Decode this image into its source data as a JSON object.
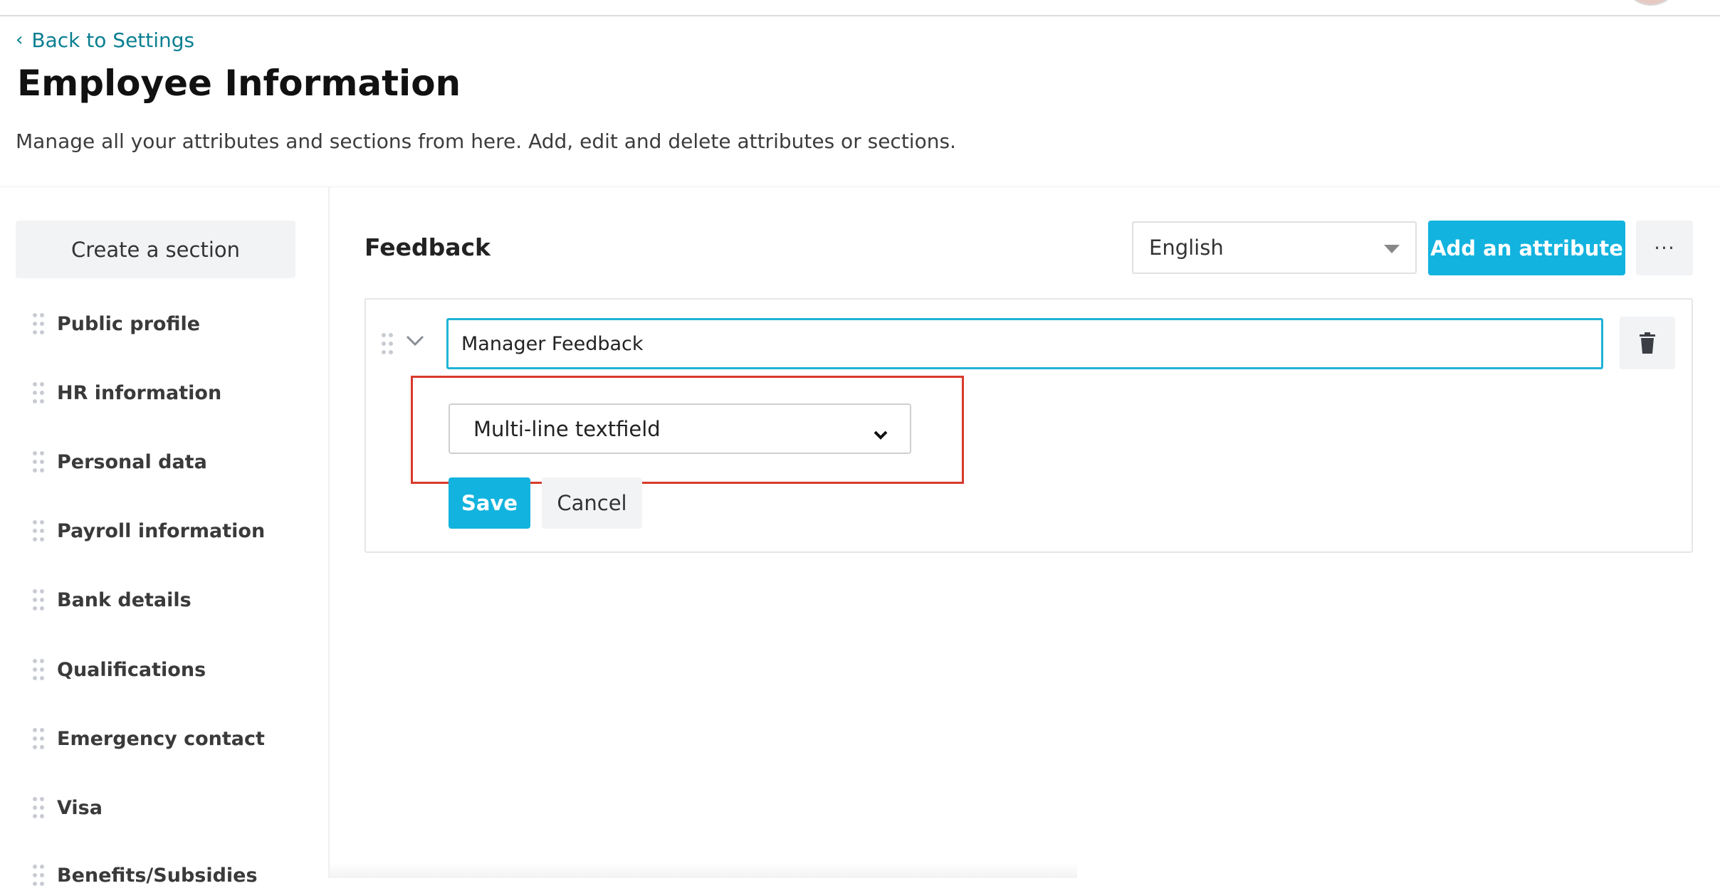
{
  "header": {
    "back_label": "Back to Settings",
    "title": "Employee Information",
    "description": "Manage all your attributes and sections from here. Add, edit and delete attributes or sections."
  },
  "sidebar": {
    "create_label": "Create a section",
    "items": [
      {
        "label": "Public profile"
      },
      {
        "label": "HR information"
      },
      {
        "label": "Personal data"
      },
      {
        "label": "Payroll information"
      },
      {
        "label": "Bank details"
      },
      {
        "label": "Qualifications"
      },
      {
        "label": "Emergency contact"
      },
      {
        "label": "Visa"
      },
      {
        "label": "Benefits/Subsidies"
      }
    ]
  },
  "main": {
    "section_title": "Feedback",
    "language": "English",
    "add_attribute_label": "Add an attribute",
    "more_label": "···",
    "attribute": {
      "name_value": "Manager Feedback",
      "type_value": "Multi-line textfield",
      "save_label": "Save",
      "cancel_label": "Cancel"
    }
  },
  "colors": {
    "accent": "#12b3df",
    "link": "#0a7f91",
    "highlight": "#d93a2b"
  },
  "icons": [
    "chevron-left-icon",
    "drag-handle-icon",
    "chevron-down-icon",
    "trash-icon",
    "caret-down-icon",
    "more-icon"
  ]
}
